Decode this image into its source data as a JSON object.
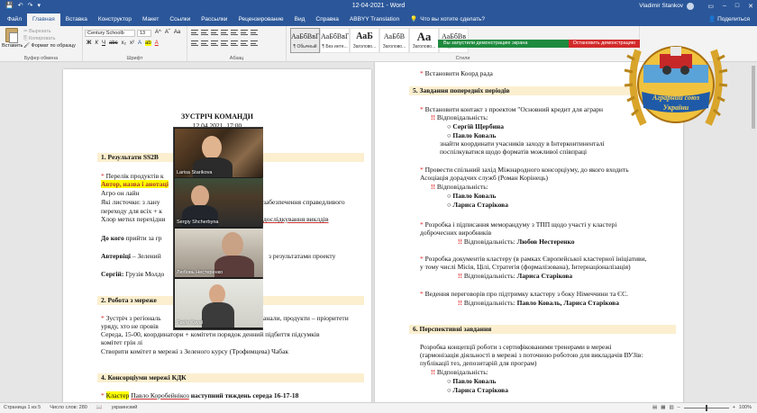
{
  "window": {
    "title": "12-04-2021 - Word",
    "user": "Vladimir Stankov",
    "share": "Поделиться",
    "tell_me": "Что вы хотите сделать?"
  },
  "tabs": [
    "Файл",
    "Главная",
    "Вставка",
    "Конструктор",
    "Макет",
    "Ссылки",
    "Рассылки",
    "Рецензирование",
    "Вид",
    "Справка",
    "ABBYY Translation"
  ],
  "ribbon": {
    "paste": "Вставить",
    "cut": "Вырезать",
    "copy": "Копировать",
    "format_painter": "Формат по образцу",
    "clipboard_group": "Буфер обмена",
    "font_name": "Century Schoolb",
    "font_size": "13",
    "font_group": "Шрифт",
    "paragraph_group": "Абзац",
    "styles_group": "Стили",
    "styles": [
      {
        "sample": "АаБбВвГ",
        "name": "¶ Обычный"
      },
      {
        "sample": "АаБбВвГ",
        "name": "¶ Без инте..."
      },
      {
        "sample": "АаБ",
        "name": "Заголово..."
      },
      {
        "sample": "АаБбВ",
        "name": "Заголово..."
      },
      {
        "sample": "Аа",
        "name": "Заголово..."
      },
      {
        "sample": "АаБбВв",
        "name": "Подзагол..."
      }
    ]
  },
  "notification": {
    "presenting": "Вы запустили демонстрацию экрана",
    "stop": "Остановить демонстрацию"
  },
  "page1": {
    "title": "ЗУСТРІЧ КОМАНДИ",
    "date": "12.04.2021, 17:00",
    "h1": "1. Результати SS2B",
    "l1": "Перелік продуктів к",
    "l2": "Автор, назва і анотаці",
    "l3": "Агро он лайн",
    "l4": "Які листочки: з лану",
    "l4b": "забезпечення справедливого",
    "l5": "переходу для всіх + к",
    "l6": "Хлор метил перехідни",
    "l6b": "дослідкування виклдів",
    "l7a": "До кого",
    "l7b": "прийти за гр",
    "l8a": "Автервіці",
    "l8b": "– Зелений",
    "l8c": "з результатами проекту",
    "l9a": "Сергій:",
    "l9b": "Грузія Молдо",
    "h2": "2. Робота з мереже",
    "m1": "Зустріч з регіональ",
    "m1b": "анали, продукти – пріоритети",
    "m2": "уряду, хто не провів",
    "m3": "Середа, 15-00, координатори + комітети порядок денний підбиття підсумків",
    "m4": "комітет грін лі",
    "m5": "Створити комітет в мережі з Зеленого курсу (Трофимцева) Чабак",
    "h4": "4. Консорціуми мережі КДК",
    "k1a": "Кластер",
    "k1b": "Павло Коробейнікоз",
    "k1c": "наступний тиждень середа 16-17-18"
  },
  "page2": {
    "t0": "Встановити Коорд рада",
    "h5": "5. Завдання попередніх періодів",
    "a1": "Встановити контакт з проектом \"Основний кредит для аграрн",
    "a2": "Відповідальність:",
    "a3": "Сергій Щербина",
    "a4": "Павло Коваль",
    "a5": "знайти координати учасників заходу в Інтерконтиненталі",
    "a6": "поспілкуватися щодо форматів можливої співпраці",
    "b1": "Провести спільний захід Міжнародного консорціуму, до якого входить",
    "b2": "Асоціація дорадчих служб (Роман Корінець)",
    "b3": "Відповідальність:",
    "b4": "Павло Коваль",
    "b5": "Лариса Старікова",
    "c1": "Розробка і підписання меморандуму з ТПП щодо участі у кластері",
    "c2": "доброчесних виробників",
    "c3": "Відповідальність:",
    "c4": "Любов Нестеренко",
    "d1": "Розробка документів кластеру (в рамках Європейської кластерної ініціативи,",
    "d2": "у тому числі Місія, Цілі, Стратегія (формалізована), Інтернаціоналізація)",
    "d3": "Відповідальність:",
    "d4": "Лариса Старікова",
    "e1": "Ведення переговорів про підтримку кластеру з боку Німеччини та ЄС.",
    "e2": "Відповідальність:",
    "e3": "Павло Коваль, Лариса Старікова",
    "h6": "6. Перспективні завдання",
    "f1": "Розробка концепції роботи з сертифікованими тренерами в мережі",
    "f2": "(гармонізація діяльності в мережі з поточною роботою для викладачів ВУЗів:",
    "f3": "публікації тез, депозитарій для програм)",
    "f4": "Відповідальність:",
    "f5": "Павло Коваль",
    "f6": "Лариса Старікова"
  },
  "video": [
    {
      "name": "Larisa Starikova"
    },
    {
      "name": "Sergiy Shcherbyna"
    },
    {
      "name": "Любовь Нестеренко"
    },
    {
      "name": "Pavlo Koval"
    }
  ],
  "logo": {
    "line1": "Аграрний союз",
    "line2": "України"
  },
  "status": {
    "page": "Страница 1 из 5",
    "words": "Число слов: 280",
    "lang": "украинский",
    "zoom": "100%"
  },
  "colors": {
    "accent": "#2b579a",
    "heading_bg": "#fbefcf",
    "bullet": "#e02020",
    "highlight": "#ffff00"
  }
}
